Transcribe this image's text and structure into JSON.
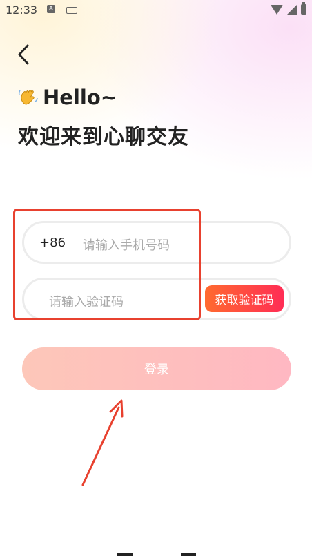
{
  "status_bar": {
    "time": "12:33",
    "notification_icon": "a-icon",
    "keyboard_icon": "keyboard-icon",
    "wifi_icon": "wifi-icon",
    "signal_icon": "signal-icon",
    "battery_icon": "battery-icon"
  },
  "header": {
    "back_icon": "chevron-left-icon",
    "wave_icon": "waving-hand-icon",
    "greeting": "Hello~",
    "subtitle": "欢迎来到心聊交友"
  },
  "form": {
    "country_code": "+86",
    "phone_placeholder": "请输入手机号码",
    "phone_value": "",
    "code_placeholder": "请输入验证码",
    "code_value": "",
    "get_code_label": "获取验证码",
    "login_label": "登录"
  },
  "colors": {
    "accent_start": "#ff6a2f",
    "accent_end": "#ff2d55",
    "annotation": "#e8412f"
  }
}
